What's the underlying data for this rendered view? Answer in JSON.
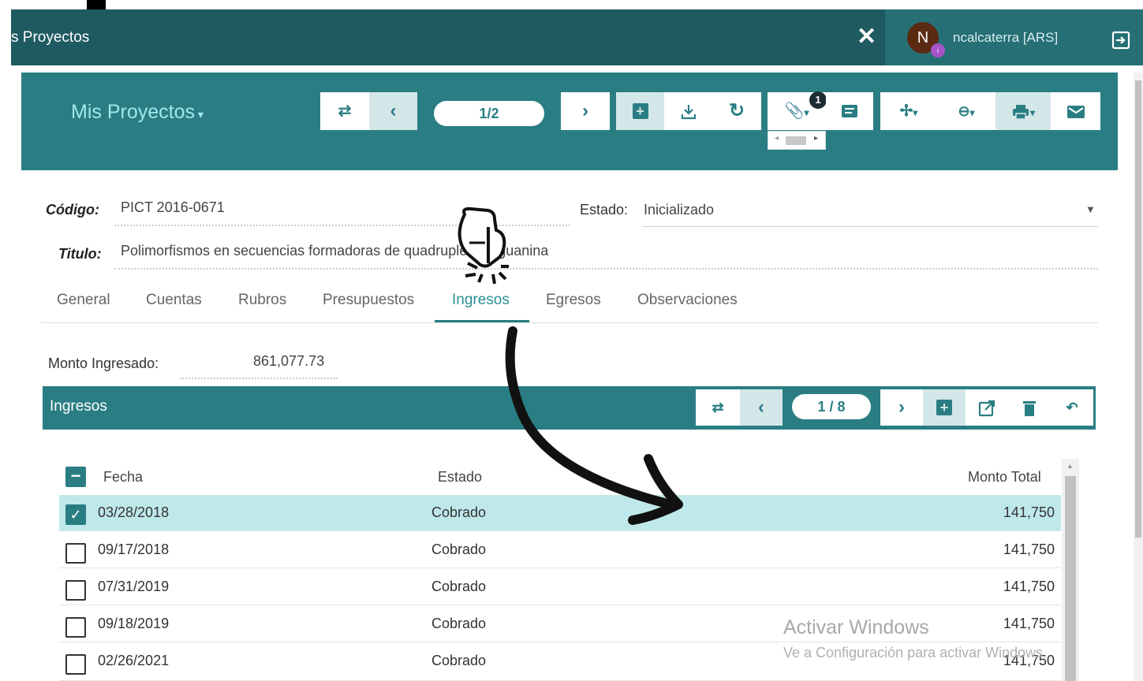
{
  "topbar": {
    "title": "s Proyectos",
    "close_icon": "close-icon",
    "user": {
      "initial": "N",
      "dot": "i",
      "name": "ncalcaterra [ARS]"
    },
    "logout_icon": "logout-icon"
  },
  "panel": {
    "title": "Mis Proyectos",
    "pager": "1/2",
    "attachment_count": "1",
    "icons": [
      "swap-icon",
      "prev-icon",
      "next-icon",
      "add-icon",
      "download-icon",
      "refresh-icon",
      "paperclip-icon",
      "comment-icon",
      "fan-icon",
      "link-icon",
      "print-icon",
      "mail-icon"
    ]
  },
  "form": {
    "codigo_label": "Código:",
    "codigo_value": "PICT 2016-0671",
    "estado_label": "Estado:",
    "estado_value": "Inicializado",
    "titulo_label": "Titulo:",
    "titulo_value": "Polimorfismos en secuencias formadoras de quadruplex de guanina"
  },
  "tabs": [
    "General",
    "Cuentas",
    "Rubros",
    "Presupuestos",
    "Ingresos",
    "Egresos",
    "Observaciones"
  ],
  "active_tab": "Ingresos",
  "monto": {
    "label": "Monto Ingresado:",
    "value": "861,077.73"
  },
  "ingresos": {
    "title": "Ingresos",
    "pager": "1 / 8",
    "columns": [
      "Fecha",
      "Estado",
      "Monto Total"
    ],
    "rows": [
      {
        "fecha": "03/28/2018",
        "estado": "Cobrado",
        "monto": "141,750",
        "selected": true
      },
      {
        "fecha": "09/17/2018",
        "estado": "Cobrado",
        "monto": "141,750",
        "selected": false
      },
      {
        "fecha": "07/31/2019",
        "estado": "Cobrado",
        "monto": "141,750",
        "selected": false
      },
      {
        "fecha": "09/18/2019",
        "estado": "Cobrado",
        "monto": "141,750",
        "selected": false
      },
      {
        "fecha": "02/26/2021",
        "estado": "Cobrado",
        "monto": "141,750",
        "selected": false
      }
    ]
  },
  "watermark": {
    "line1": "Activar Windows",
    "line2": "Ve a Configuración para activar Windows."
  },
  "colors": {
    "header": "#1e5a60",
    "accent": "#2a7e83",
    "selected_row": "#bfe8ea"
  }
}
